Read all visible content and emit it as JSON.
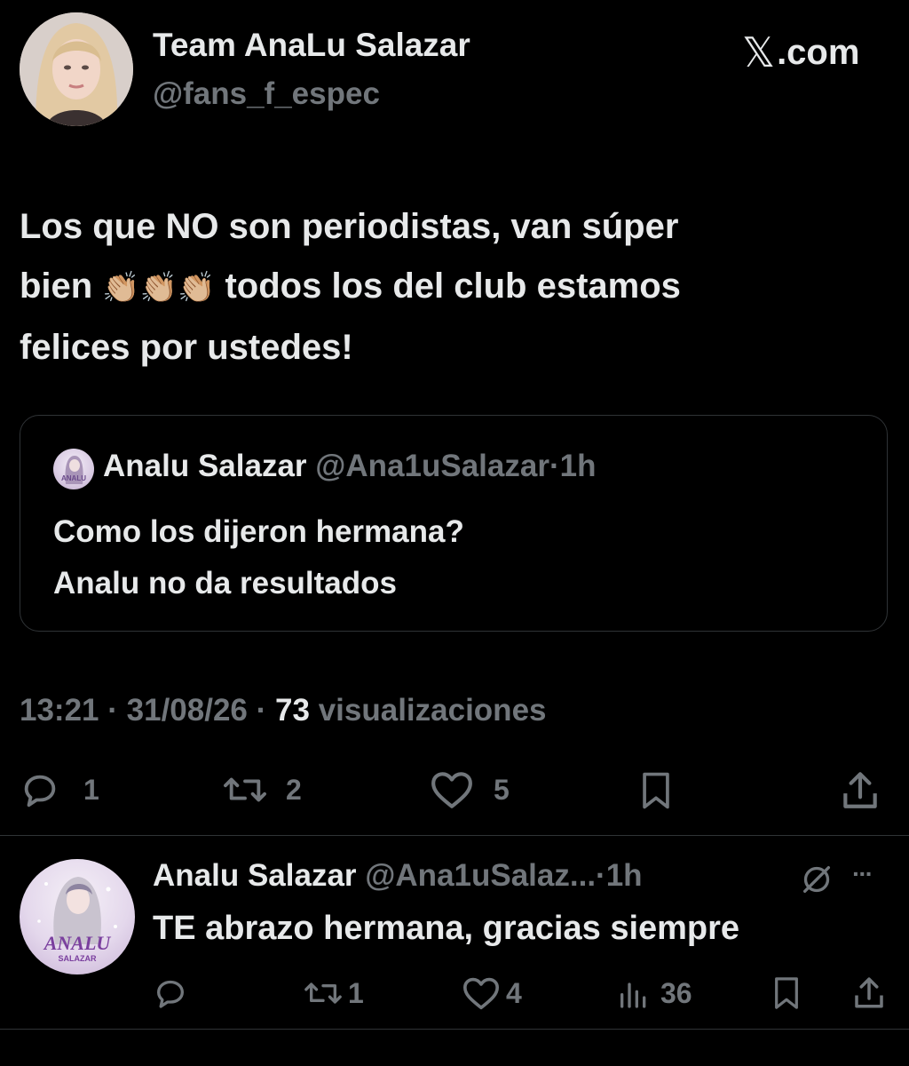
{
  "tweet": {
    "author_name": "Team AnaLu Salazar",
    "author_handle": "@fans_f_espec",
    "source_label": ".com",
    "source_glyph": "𝕏",
    "text_line1": "Los que NO son periodistas, van súper",
    "text_line2_before": "bien ",
    "text_emoji": "👏🏼👏🏼👏🏼",
    "text_line2_after": " todos los del club estamos",
    "text_line3": "felices por ustedes!",
    "quote": {
      "name": "Analu Salazar",
      "handle": "@Ana1uSalazar",
      "separator": "·",
      "time": "1h",
      "avatar_text": "ANALU",
      "line1": "Como los dijeron hermana?",
      "line2": "Analu no da resultados"
    },
    "meta": {
      "time": "13:21",
      "sep1": "·",
      "date": "31/08/26",
      "sep2": "·",
      "views_count": "73",
      "views_label": "visualizaciones"
    },
    "actions": {
      "replies": "1",
      "reposts": "2",
      "likes": "5"
    }
  },
  "reply": {
    "name": "Analu Salazar",
    "handle": "@Ana1uSalaz...",
    "separator": "·",
    "time": "1h",
    "more": "···",
    "avatar_title": "ANALU",
    "avatar_subtitle": "SALAZAR",
    "text": "TE abrazo hermana, gracias siempre",
    "actions": {
      "reposts": "1",
      "likes": "4",
      "views": "36"
    }
  },
  "colors": {
    "background": "#000000",
    "primary_text": "#e7e9ea",
    "secondary_text": "#71767b",
    "border": "#2f3336"
  }
}
